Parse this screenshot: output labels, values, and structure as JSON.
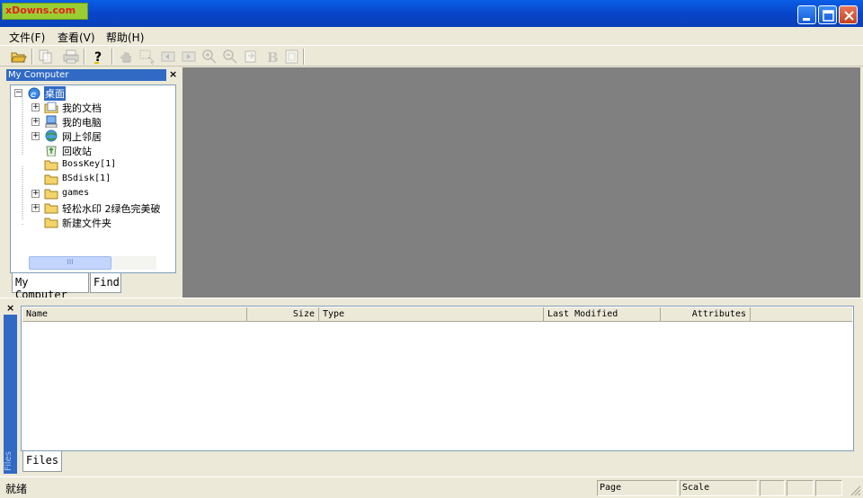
{
  "window": {
    "logo": "xDowns.com",
    "minimize_icon": "minimize-icon",
    "maximize_icon": "maximize-icon",
    "close_icon": "close-icon"
  },
  "menu": {
    "items": [
      {
        "label": "文件(F)"
      },
      {
        "label": "查看(V)"
      },
      {
        "label": "帮助(H)"
      }
    ]
  },
  "toolbar": {
    "buttons": [
      {
        "icon": "open-folder-icon",
        "enabled": true
      },
      {
        "icon": "copy-icon",
        "enabled": false
      },
      {
        "icon": "print-icon",
        "enabled": false
      },
      {
        "icon": "help-icon",
        "enabled": true
      },
      {
        "icon": "hand-icon",
        "enabled": false
      },
      {
        "icon": "select-icon",
        "enabled": false
      },
      {
        "icon": "previous-icon",
        "enabled": false
      },
      {
        "icon": "next-icon",
        "enabled": false
      },
      {
        "icon": "zoom-in-icon",
        "enabled": false
      },
      {
        "icon": "zoom-out-icon",
        "enabled": false
      },
      {
        "icon": "rotate-icon",
        "enabled": false
      },
      {
        "icon": "bold-icon",
        "enabled": false
      },
      {
        "icon": "fit-page-icon",
        "enabled": false
      }
    ],
    "bold_glyph": "B"
  },
  "tree_panel": {
    "title": "My Computer",
    "close": "×",
    "items": [
      {
        "label": "桌面",
        "icon": "desktop-icon",
        "expander": "−",
        "selected": true
      },
      {
        "label": "我的文档",
        "icon": "documents-icon",
        "expander": "+"
      },
      {
        "label": "我的电脑",
        "icon": "computer-icon",
        "expander": "+"
      },
      {
        "label": "网上邻居",
        "icon": "network-icon",
        "expander": "+"
      },
      {
        "label": "回收站",
        "icon": "recycle-bin-icon",
        "expander": ""
      },
      {
        "label": "BossKey[1]",
        "icon": "folder-icon",
        "expander": ""
      },
      {
        "label": "BSdisk[1]",
        "icon": "folder-icon",
        "expander": ""
      },
      {
        "label": "games",
        "icon": "folder-icon",
        "expander": "+"
      },
      {
        "label": "轻松水印 2绿色完美破",
        "icon": "folder-icon",
        "expander": "+"
      },
      {
        "label": "新建文件夹",
        "icon": "folder-icon",
        "expander": ""
      }
    ],
    "scroll_grip": "III",
    "tabs": [
      {
        "label": "My Computer",
        "active": true
      },
      {
        "label": "Find",
        "active": false
      }
    ]
  },
  "files_panel": {
    "close": "×",
    "side_label": "Files",
    "columns": [
      {
        "label": "Name"
      },
      {
        "label": "Size"
      },
      {
        "label": "Type"
      },
      {
        "label": "Last Modified"
      },
      {
        "label": "Attributes"
      }
    ],
    "tab": "Files"
  },
  "status": {
    "text": "就绪",
    "page_label": "Page",
    "scale_label": "Scale"
  },
  "colors": {
    "title_bar": "#0a5ee6",
    "selection": "#316ac5",
    "viewer_bg": "#808080",
    "chrome": "#ece9d8"
  }
}
